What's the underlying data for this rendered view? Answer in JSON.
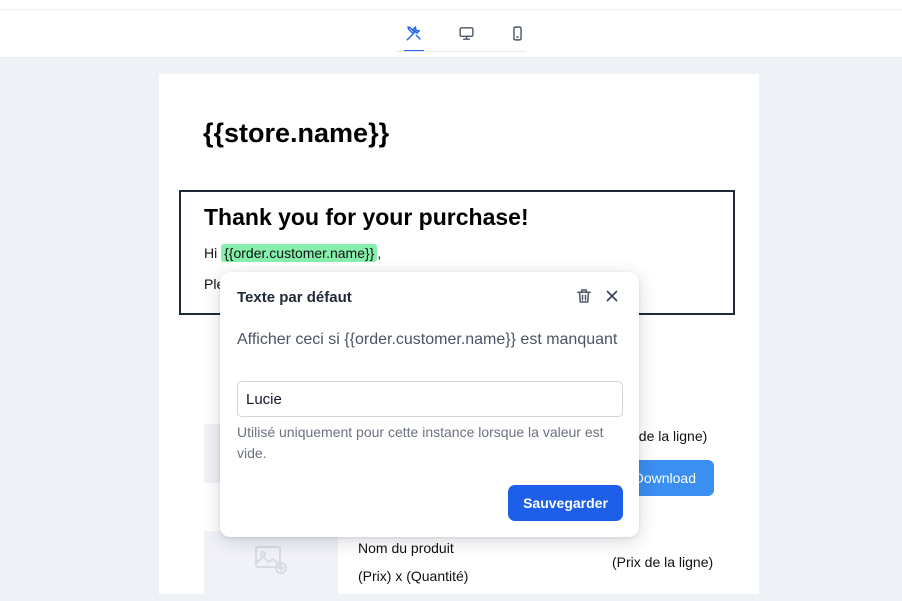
{
  "toolbar": {
    "tabs": [
      {
        "icon": "tools-icon",
        "active": true
      },
      {
        "icon": "desktop-icon",
        "active": false
      },
      {
        "icon": "mobile-icon",
        "active": false
      }
    ],
    "accent_color": "#2563eb"
  },
  "email": {
    "store_name": "{{store.name}}",
    "heading": "Thank you for your purchase!",
    "greeting_prefix": "Hi",
    "greeting_variable": "{{order.customer.name}}",
    "greeting_suffix": ",",
    "paragraph_start": "Ple",
    "line_price_partial": "t de la ligne)",
    "download_label": "Download",
    "product_name": "Nom du produit",
    "product_qty": "(Prix) x (Quantité)",
    "line_price": "(Prix de la ligne)"
  },
  "popup": {
    "title": "Texte par défaut",
    "prompt": "Afficher ceci si {{order.customer.name}} est manquant",
    "input_value": "Lucie",
    "help_text": "Utilisé uniquement pour cette instance lorsque la valeur est vide.",
    "save_label": "Sauvegarder",
    "save_color": "#1d5fe8"
  }
}
